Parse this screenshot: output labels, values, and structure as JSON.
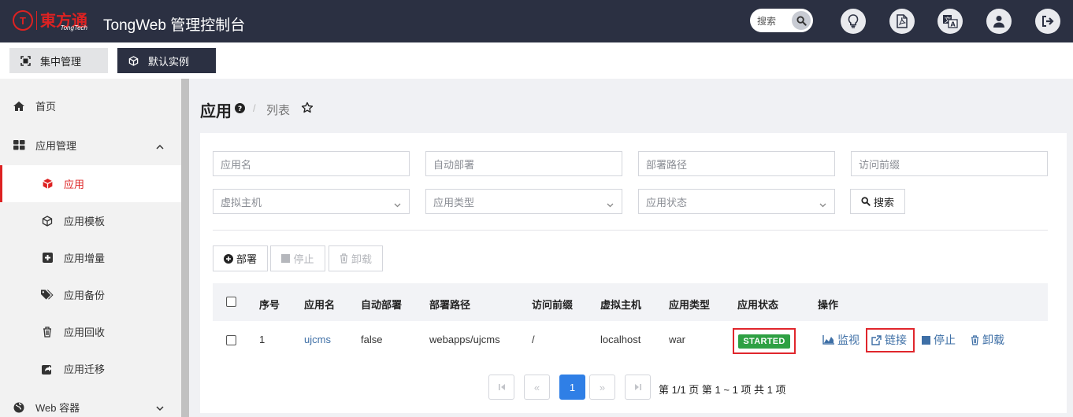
{
  "topbar": {
    "logo_badge": "T",
    "logo_cn": "東方通",
    "logo_en": "TongTech",
    "title": "TongWeb 管理控制台",
    "search_label": "搜索",
    "icons": [
      "lightbulb-icon",
      "pdf-icon",
      "translate-icon",
      "user-icon",
      "logout-icon"
    ]
  },
  "subbar": {
    "central_label": "集中管理",
    "default_instance_label": "默认实例"
  },
  "sidebar": {
    "items": [
      {
        "label": "首页",
        "icon": "home-icon"
      },
      {
        "label": "应用管理",
        "icon": "grid-icon"
      },
      {
        "label": "应用",
        "icon": "cube-icon"
      },
      {
        "label": "应用模板",
        "icon": "cube-outline-icon"
      },
      {
        "label": "应用增量",
        "icon": "plus-square-icon"
      },
      {
        "label": "应用备份",
        "icon": "tags-icon"
      },
      {
        "label": "应用回收",
        "icon": "trash-icon"
      },
      {
        "label": "应用迁移",
        "icon": "share-icon"
      },
      {
        "label": "Web 容器",
        "icon": "globe-icon"
      }
    ]
  },
  "page": {
    "title": "应用",
    "breadcrumb": "列表"
  },
  "filters": {
    "app_name": "应用名",
    "auto_deploy": "自动部署",
    "deploy_path": "部署路径",
    "access_prefix": "访问前缀",
    "virtual_host": "虚拟主机",
    "app_type": "应用类型",
    "app_status": "应用状态",
    "search_button": "搜索"
  },
  "actions": {
    "deploy": "部署",
    "stop": "停止",
    "uninstall": "卸载"
  },
  "table": {
    "headers": [
      "序号",
      "应用名",
      "自动部署",
      "部署路径",
      "访问前缀",
      "虚拟主机",
      "应用类型",
      "应用状态",
      "操作"
    ],
    "rows": [
      {
        "index": "1",
        "name": "ujcms",
        "auto_deploy": "false",
        "path": "webapps/ujcms",
        "prefix": "/",
        "host": "localhost",
        "type": "war",
        "status": "STARTED",
        "ops": [
          "监视",
          "链接",
          "停止",
          "卸载"
        ]
      }
    ]
  },
  "pagination": {
    "first": "|‹",
    "prev": "«",
    "current": "1",
    "next": "»",
    "last": "›|",
    "info": "第 1/1 页  第 1 ~ 1 项  共 1 项"
  },
  "colors": {
    "topbar": "#2b3042",
    "accent_red": "#d22222",
    "status_green": "#2ea043",
    "link_blue": "#3e6fa6",
    "pager_active": "#2f7fe6"
  }
}
